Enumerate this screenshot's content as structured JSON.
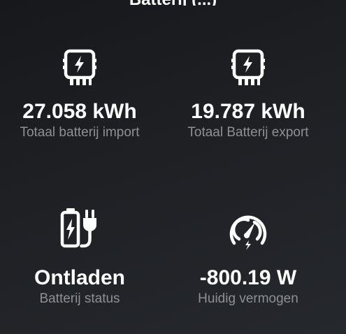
{
  "header": {
    "title_partial": "Batterij (...)"
  },
  "tiles": [
    {
      "icon": "inverter-bolt-icon",
      "value": "27.058 kWh",
      "label": "Totaal batterij import"
    },
    {
      "icon": "inverter-bolt-icon",
      "value": "19.787 kWh",
      "label": "Totaal Batterij export"
    },
    {
      "icon": "battery-plug-icon",
      "value": "Ontladen",
      "label": "Batterij status"
    },
    {
      "icon": "gauge-bolt-icon",
      "value": "-800.19 W",
      "label": "Huidig vermogen"
    }
  ],
  "colors": {
    "background": "#1c1e21",
    "value_text": "#ffffff",
    "label_text": "#8d9095"
  }
}
